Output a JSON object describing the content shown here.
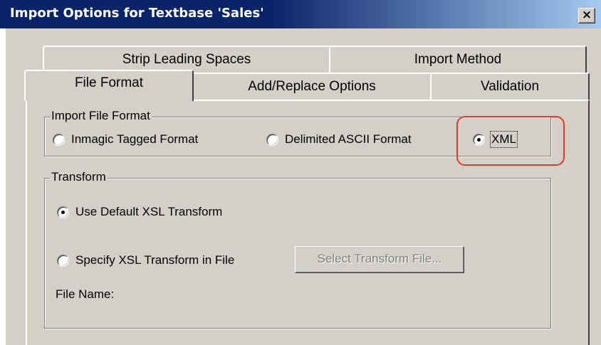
{
  "window": {
    "title": "Import Options for Textbase 'Sales'",
    "close_label": "×"
  },
  "tabs": {
    "row1": [
      "Strip Leading Spaces",
      "Import Method"
    ],
    "row2": [
      "File Format",
      "Add/Replace Options",
      "Validation"
    ],
    "active": "File Format"
  },
  "import_format": {
    "legend": "Import File Format",
    "options": [
      {
        "label": "Inmagic Tagged Format",
        "checked": false
      },
      {
        "label": "Delimited ASCII Format",
        "checked": false
      },
      {
        "label": "XML",
        "checked": true
      }
    ]
  },
  "transform": {
    "legend": "Transform",
    "default_label": "Use Default XSL Transform",
    "default_checked": true,
    "specify_label": "Specify XSL Transform in File",
    "specify_checked": false,
    "select_button": "Select Transform File...",
    "file_name_label": "File Name:"
  },
  "colors": {
    "title_bar": "#0a246a",
    "dialog_bg": "#d4d0c8",
    "highlight": "#e8362c"
  }
}
